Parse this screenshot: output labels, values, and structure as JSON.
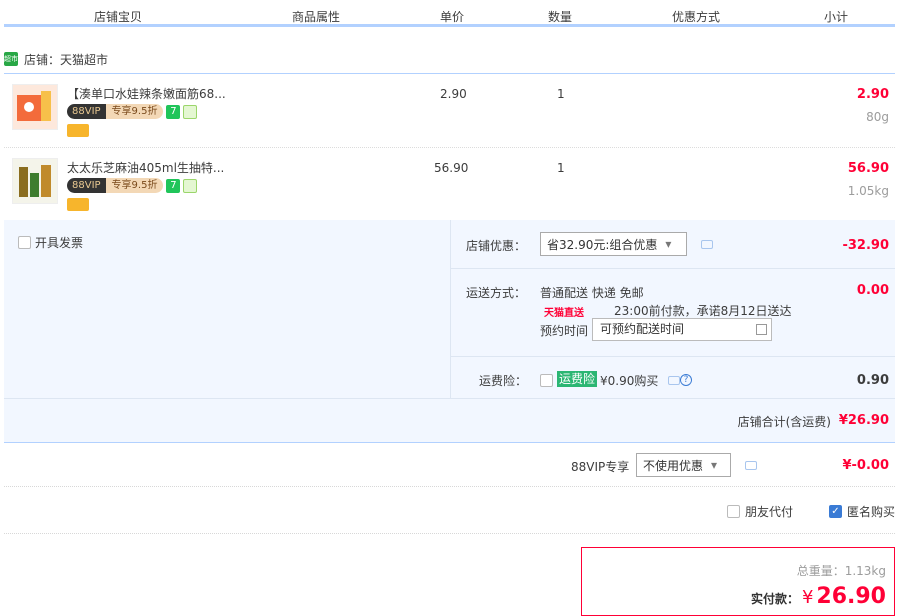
{
  "header": {
    "col_item": "店铺宝贝",
    "col_attr": "商品属性",
    "col_price": "单价",
    "col_qty": "数量",
    "col_promo": "优惠方式",
    "col_subtotal": "小计"
  },
  "shop": {
    "icon_text": "超市",
    "label": "店铺：天猫超市"
  },
  "items": [
    {
      "title": "【湊单口水娃辣条嫩面筋68...",
      "vip_a": "88VIP",
      "vip_b": "专享9.5折",
      "tag_7": "7",
      "price": "2.90",
      "qty": "1",
      "subtotal": "2.90",
      "weight": "80g"
    },
    {
      "title": "太太乐芝麻油405ml生抽特...",
      "vip_a": "88VIP",
      "vip_b": "专享9.5折",
      "tag_7": "7",
      "price": "56.90",
      "qty": "1",
      "subtotal": "56.90",
      "weight": "1.05kg"
    }
  ],
  "summary": {
    "invoice_label": "开具发票",
    "shop_discount_label": "店铺优惠：",
    "shop_discount_value": "省32.90元:组合优惠",
    "shop_discount_amount": "-32.90",
    "shipping_label": "运送方式：",
    "shipping_method": "普通配送 快递 免邮",
    "tmall_direct": "天猫直送",
    "delivery_promise": "23:00前付款，承诺8月12日送达",
    "shipping_amount": "0.00",
    "appointment_label": "预约时间",
    "appointment_value": "可预约配送时间",
    "insurance_label": "运费险：",
    "insurance_badge": "运费险",
    "insurance_price": "¥0.90购买",
    "insurance_amount": "0.90",
    "shop_total_label": "店铺合计(含运费)",
    "shop_total_value": "¥26.90"
  },
  "vip88": {
    "label": "88VIP专享",
    "select_value": "不使用优惠",
    "amount": "¥-0.00"
  },
  "options": {
    "friend_pay": "朋友代付",
    "anonymous": "匿名购买"
  },
  "pay": {
    "weight": "总重量：1.13kg",
    "label": "实付款：",
    "symbol": "¥",
    "value": "26.90"
  },
  "colors": {
    "accent_red": "#ff0036",
    "blue_line": "#b2d1ff",
    "summary_bg": "#f2f7ff"
  }
}
